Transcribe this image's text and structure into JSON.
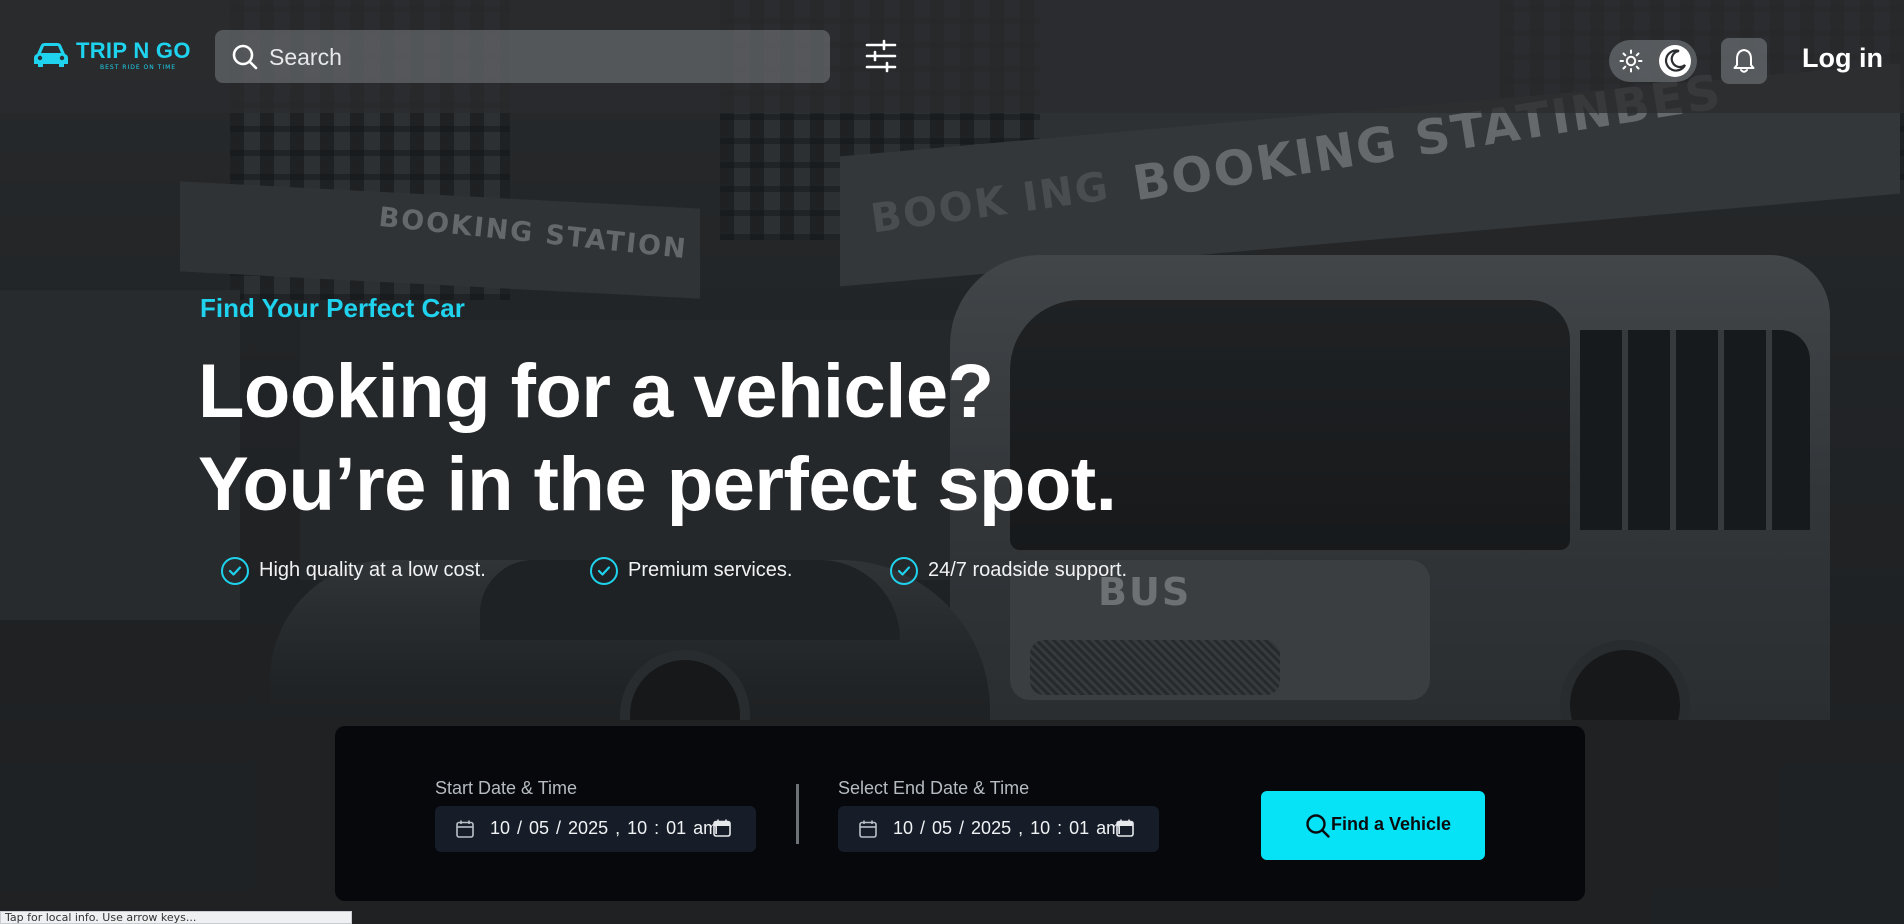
{
  "header": {
    "logo": {
      "name": "TRIP N GO",
      "tagline": "BEST RIDE ON TIME",
      "icon": "car-icon"
    },
    "search": {
      "placeholder": "Search",
      "value": "",
      "icon": "search-icon"
    },
    "filter_icon": "sliders-icon",
    "theme_toggle": {
      "light_icon": "sun-icon",
      "dark_icon": "moon-icon"
    },
    "notifications_icon": "bell-icon",
    "login_label": "Log in"
  },
  "hero": {
    "eyebrow": "Find Your Perfect Car",
    "headline_line1": "Looking for a vehicle?",
    "headline_line2": "You’re in the perfect spot.",
    "features": [
      {
        "label": "High quality at a low cost.",
        "icon": "check-circle-icon"
      },
      {
        "label": "Premium services.",
        "icon": "check-circle-icon"
      },
      {
        "label": "24/7 roadside support.",
        "icon": "check-circle-icon"
      }
    ],
    "background_signs": [
      "BOOKING STATION",
      "BOOKING STATINBES",
      "BOOK ING",
      "BUS"
    ]
  },
  "booking": {
    "start": {
      "label": "Start Date & Time",
      "value": "10 / 05 / 2025 ,  10 : 01   am"
    },
    "end": {
      "label": "Select End Date & Time",
      "value": "10 / 05 / 2025 ,  10 : 01   am"
    },
    "find_button_label": "Find a Vehicle",
    "find_button_icon": "search-icon"
  },
  "statusbar": {
    "text": "Tap for local info. Use arrow keys..."
  },
  "colors": {
    "accent": "#06e3f7",
    "accent_text": "#1fd3ee",
    "panel_bg": "#06080b",
    "field_bg": "#161d29"
  }
}
